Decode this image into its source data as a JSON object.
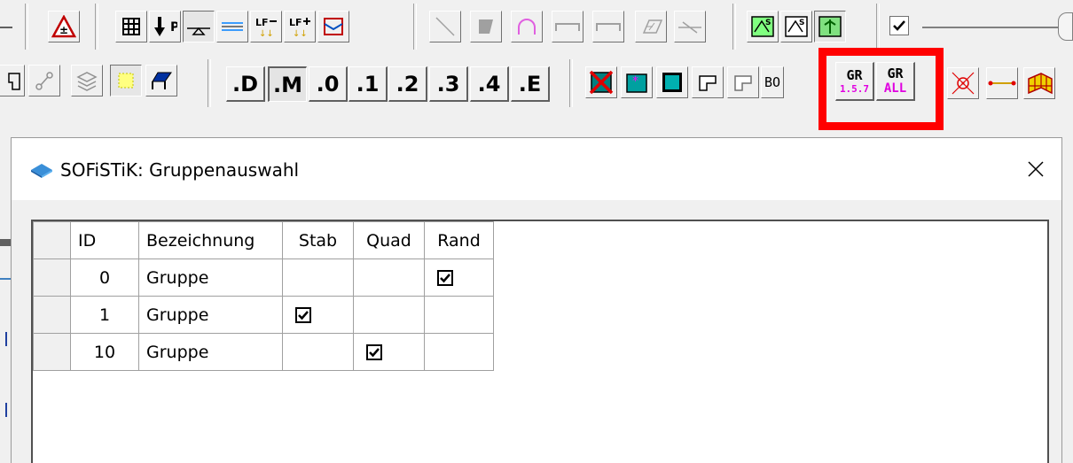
{
  "toolbar_row2": {
    "digit_buttons": [
      ".D",
      ".M",
      ".0",
      ".1",
      ".2",
      ".3",
      ".4",
      ".E"
    ],
    "bo_label": "BO"
  },
  "group_buttons": {
    "gr_157": {
      "top": "GR",
      "sub": "1.5.7"
    },
    "gr_all": {
      "top": "GR",
      "sub": "ALL"
    }
  },
  "dialog": {
    "title": "SOFiSTiK: Gruppenauswahl",
    "table": {
      "columns": [
        "ID",
        "Bezeichnung",
        "Stab",
        "Quad",
        "Rand"
      ],
      "rows": [
        {
          "id": "0",
          "name": "Gruppe",
          "stab": false,
          "quad": false,
          "rand": true
        },
        {
          "id": "1",
          "name": "Gruppe",
          "stab": true,
          "quad": false,
          "rand": false
        },
        {
          "id": "10",
          "name": "Gruppe",
          "stab": false,
          "quad": true,
          "rand": false
        }
      ]
    }
  },
  "colors": {
    "highlight": "#ff0000",
    "gr_sub": "#e000e0"
  }
}
